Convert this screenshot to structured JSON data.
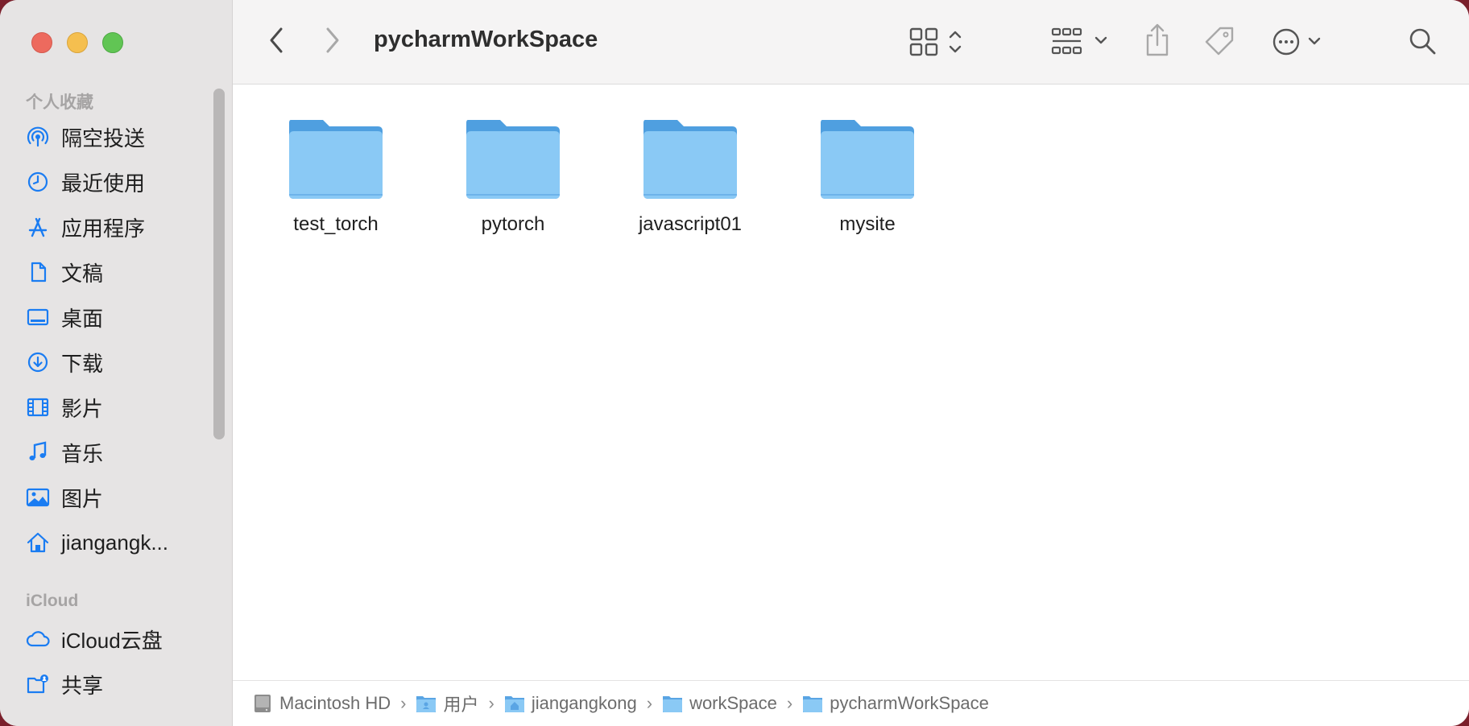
{
  "window": {
    "title": "pycharmWorkSpace"
  },
  "sidebar": {
    "favorites_title": "个人收藏",
    "icloud_title": "iCloud",
    "favorites": [
      {
        "label": "隔空投送",
        "icon": "airdrop-icon"
      },
      {
        "label": "最近使用",
        "icon": "clock-icon"
      },
      {
        "label": "应用程序",
        "icon": "applications-icon"
      },
      {
        "label": "文稿",
        "icon": "document-icon"
      },
      {
        "label": "桌面",
        "icon": "desktop-icon"
      },
      {
        "label": "下载",
        "icon": "download-icon"
      },
      {
        "label": "影片",
        "icon": "film-icon"
      },
      {
        "label": "音乐",
        "icon": "music-icon"
      },
      {
        "label": "图片",
        "icon": "photo-icon"
      },
      {
        "label": "jiangangk...",
        "icon": "home-icon"
      }
    ],
    "icloud": [
      {
        "label": "iCloud云盘",
        "icon": "cloud-icon"
      },
      {
        "label": "共享",
        "icon": "shared-folder-icon"
      }
    ]
  },
  "folders": [
    {
      "name": "test_torch"
    },
    {
      "name": "pytorch"
    },
    {
      "name": "javascript01"
    },
    {
      "name": "mysite"
    }
  ],
  "pathbar": {
    "items": [
      {
        "label": "Macintosh HD",
        "icon": "hard-drive-icon"
      },
      {
        "label": "用户",
        "icon": "users-folder-icon"
      },
      {
        "label": "jiangangkong",
        "icon": "home-folder-icon"
      },
      {
        "label": "workSpace",
        "icon": "folder-icon"
      },
      {
        "label": "pycharmWorkSpace",
        "icon": "folder-icon"
      }
    ]
  },
  "colors": {
    "accent": "#1a7cf2",
    "folder": "#8ac9f5",
    "sidebar_bg": "#e6e4e4"
  }
}
